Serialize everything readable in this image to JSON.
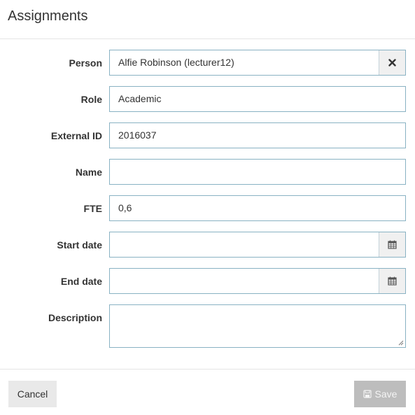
{
  "modal": {
    "title": "Assignments"
  },
  "form": {
    "person": {
      "label": "Person",
      "value": "Alfie Robinson (lecturer12)",
      "clear_icon": "close-icon"
    },
    "role": {
      "label": "Role",
      "value": "Academic"
    },
    "external_id": {
      "label": "External ID",
      "value": "2016037"
    },
    "name": {
      "label": "Name",
      "value": ""
    },
    "fte": {
      "label": "FTE",
      "value": "0,6"
    },
    "start_date": {
      "label": "Start date",
      "value": "",
      "icon": "calendar-icon"
    },
    "end_date": {
      "label": "End date",
      "value": "",
      "icon": "calendar-icon"
    },
    "description": {
      "label": "Description",
      "value": ""
    }
  },
  "footer": {
    "cancel_label": "Cancel",
    "save_label": "Save",
    "save_icon": "save-icon",
    "save_disabled": true
  },
  "colors": {
    "field_border": "#89b2c3",
    "addon_bg": "#f0f0f0",
    "cancel_bg": "#e9e9e9",
    "save_disabled_bg": "#bdbdbd"
  }
}
